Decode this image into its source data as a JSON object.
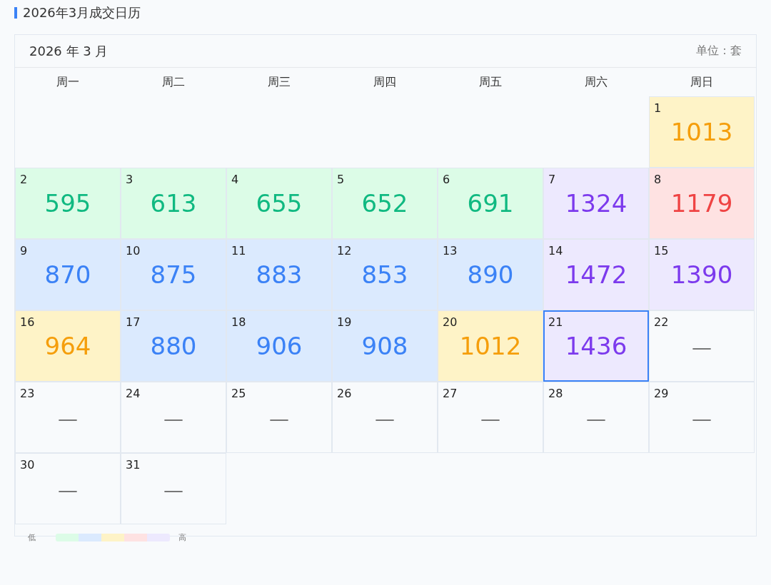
{
  "title": "2026年3月成交日历",
  "calendar": {
    "month_label": "2026 年 3 月",
    "unit": "单位：套",
    "weekdays": [
      "周一",
      "周二",
      "周三",
      "周四",
      "周五",
      "周六",
      "周日"
    ],
    "days": [
      {
        "kind": "blank"
      },
      {
        "kind": "blank"
      },
      {
        "kind": "blank"
      },
      {
        "kind": "blank"
      },
      {
        "kind": "blank"
      },
      {
        "kind": "blank"
      },
      {
        "day": "1",
        "value": "1013",
        "color": "#f59e0b",
        "selected": false
      },
      {
        "day": "2",
        "value": "595",
        "color": "#10b981",
        "selected": false
      },
      {
        "day": "3",
        "value": "613",
        "color": "#10b981",
        "selected": false
      },
      {
        "day": "4",
        "value": "655",
        "color": "#10b981",
        "selected": false
      },
      {
        "day": "5",
        "value": "652",
        "color": "#10b981",
        "selected": false
      },
      {
        "day": "6",
        "value": "691",
        "color": "#10b981",
        "selected": false
      },
      {
        "day": "7",
        "value": "1324",
        "color": "#7c3aed",
        "selected": false
      },
      {
        "day": "8",
        "value": "1179",
        "color": "#ef4444",
        "selected": false
      },
      {
        "day": "9",
        "value": "870",
        "color": "#3b82f6",
        "selected": false
      },
      {
        "day": "10",
        "value": "875",
        "color": "#3b82f6",
        "selected": false
      },
      {
        "day": "11",
        "value": "883",
        "color": "#3b82f6",
        "selected": false
      },
      {
        "day": "12",
        "value": "853",
        "color": "#3b82f6",
        "selected": false
      },
      {
        "day": "13",
        "value": "890",
        "color": "#3b82f6",
        "selected": false
      },
      {
        "day": "14",
        "value": "1472",
        "color": "#7c3aed",
        "selected": false
      },
      {
        "day": "15",
        "value": "1390",
        "color": "#7c3aed",
        "selected": false
      },
      {
        "day": "16",
        "value": "964",
        "color": "#f59e0b",
        "selected": false
      },
      {
        "day": "17",
        "value": "880",
        "color": "#3b82f6",
        "selected": false
      },
      {
        "day": "18",
        "value": "906",
        "color": "#3b82f6",
        "selected": false
      },
      {
        "day": "19",
        "value": "908",
        "color": "#3b82f6",
        "selected": false
      },
      {
        "day": "20",
        "value": "1012",
        "color": "#f59e0b",
        "selected": false
      },
      {
        "day": "21",
        "value": "1436",
        "color": "#7c3aed",
        "selected": true
      },
      {
        "day": "22",
        "value": "—",
        "selected": false
      },
      {
        "day": "23",
        "value": "—",
        "selected": false
      },
      {
        "day": "24",
        "value": "—",
        "selected": false
      },
      {
        "day": "25",
        "value": "—",
        "selected": false
      },
      {
        "day": "26",
        "value": "—",
        "selected": false
      },
      {
        "day": "27",
        "value": "—",
        "selected": false
      },
      {
        "day": "28",
        "value": "—",
        "selected": false
      },
      {
        "day": "29",
        "value": "—",
        "selected": false
      },
      {
        "day": "30",
        "value": "—",
        "selected": false
      },
      {
        "day": "31",
        "value": "—",
        "selected": false
      }
    ]
  },
  "legend": {
    "low": "低",
    "high": "高",
    "swatches": [
      {
        "color": "#dcfce7"
      },
      {
        "color": "#dbeafe"
      },
      {
        "color": "#fef3c7"
      },
      {
        "color": "#fee2e2"
      },
      {
        "color": "#ede9fe"
      }
    ]
  }
}
